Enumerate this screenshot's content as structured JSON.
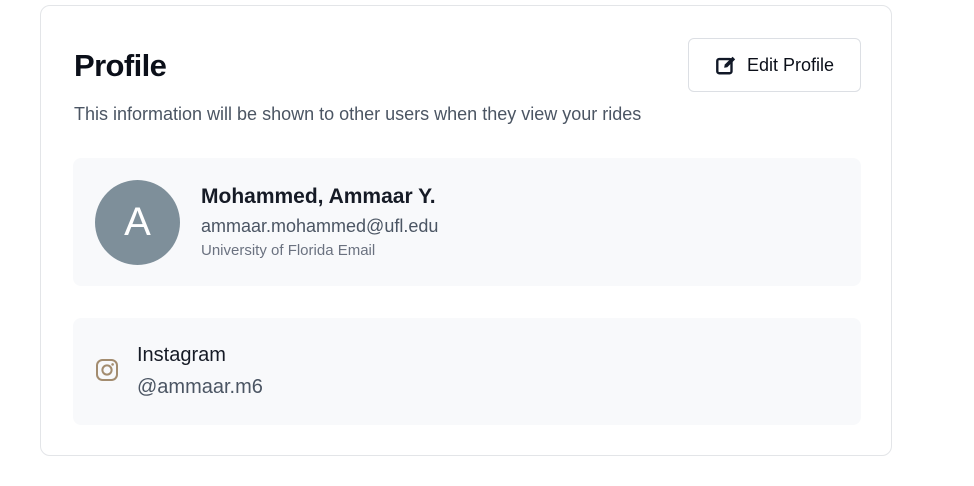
{
  "profile": {
    "title": "Profile",
    "subtitle": "This information will be shown to other users when they view your rides",
    "edit_button": {
      "label": "Edit Profile",
      "icon": "edit-icon"
    }
  },
  "user": {
    "avatar_initial": "A",
    "name": "Mohammed, Ammaar Y.",
    "email": "ammaar.mohammed@ufl.edu",
    "email_caption": "University of Florida Email"
  },
  "social": {
    "platform": "Instagram",
    "handle": "@ammaar.m6",
    "icon": "instagram-icon"
  },
  "colors": {
    "avatar_bg": "#7e8f9a",
    "instagram_icon": "#a38c6f",
    "panel_bg": "#f8f9fb"
  }
}
